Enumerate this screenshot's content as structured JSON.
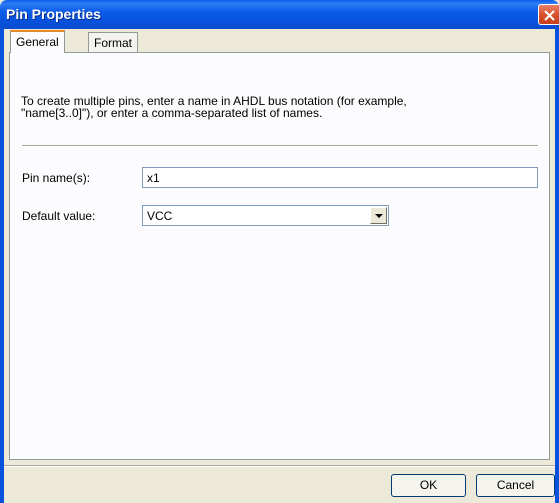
{
  "window": {
    "title": "Pin Properties",
    "title_bar_color": "#0753dd",
    "close_icon": "close-icon"
  },
  "tabs": [
    {
      "label": "General",
      "active": true
    },
    {
      "label": "Format",
      "active": false
    }
  ],
  "general": {
    "description": "To create multiple pins, enter a name in AHDL bus notation (for example,\n\"name[3..0]\"), or enter a comma-separated list of names.",
    "pin_name_label": "Pin name(s):",
    "pin_name_value": "x1",
    "default_value_label": "Default value:",
    "default_value_selected": "VCC"
  },
  "buttons": {
    "ok_label": "OK",
    "cancel_label": "Cancel"
  }
}
